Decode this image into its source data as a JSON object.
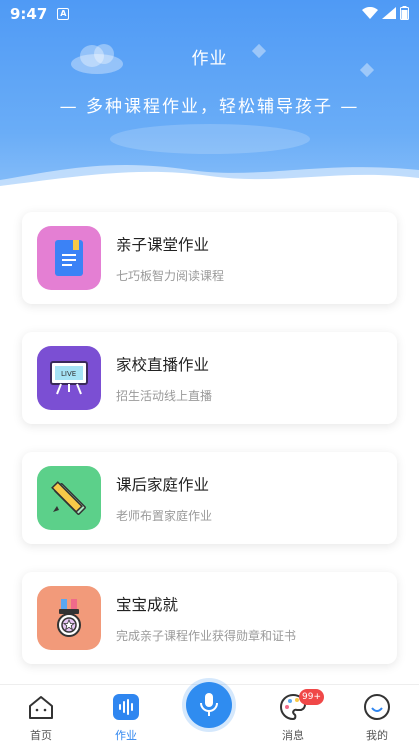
{
  "status_bar": {
    "time": "9:47",
    "notif_letter": "A"
  },
  "header": {
    "title": "作业",
    "slogan": "—  多种课程作业，轻松辅导孩子  —"
  },
  "cards": [
    {
      "title": "亲子课堂作业",
      "subtitle": "七巧板智力阅读课程",
      "icon": "book-icon",
      "color": "#e47fd3"
    },
    {
      "title": "家校直播作业",
      "subtitle": "招生活动线上直播",
      "icon": "live-board-icon",
      "color": "#7b4fd3"
    },
    {
      "title": "课后家庭作业",
      "subtitle": "老师布置家庭作业",
      "icon": "ruler-pencil-icon",
      "color": "#5cd08a"
    },
    {
      "title": "宝宝成就",
      "subtitle": "完成亲子课程作业获得勋章和证书",
      "icon": "medal-icon",
      "color": "#f29a7a"
    }
  ],
  "tabbar": {
    "home": "首页",
    "homework": "作业",
    "messages": "消息",
    "messages_badge": "99+",
    "mine": "我的"
  },
  "colors": {
    "accent": "#2f86f0"
  }
}
